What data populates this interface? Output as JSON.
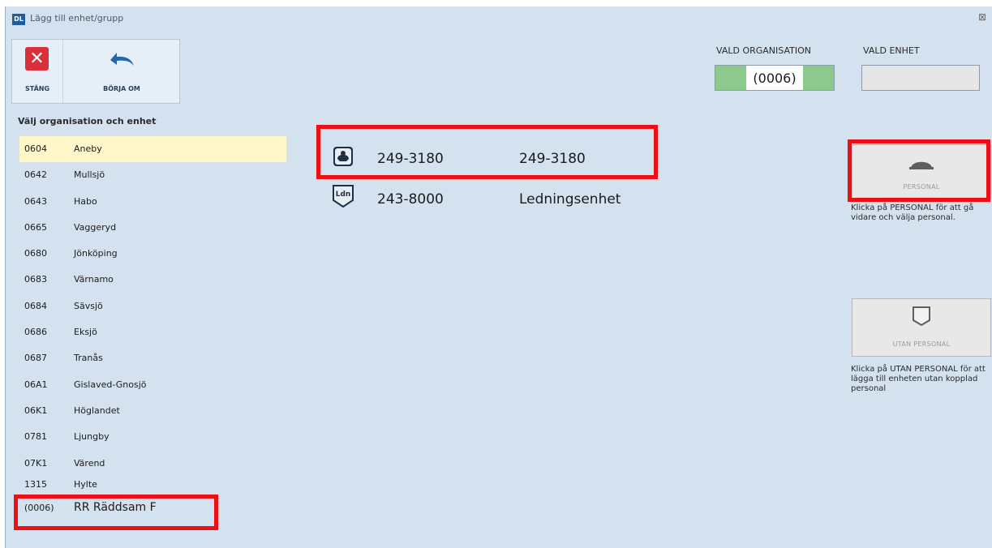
{
  "window": {
    "title": "Lägg till enhet/grupp",
    "app_icon_text": "DL",
    "close_glyph": "⊠"
  },
  "toolbar": {
    "close_label": "STÄNG",
    "restart_label": "BÖRJA OM"
  },
  "org_list": {
    "heading": "Välj organisation och enhet",
    "items": [
      {
        "code": "0604",
        "name": "Aneby"
      },
      {
        "code": "0642",
        "name": "Mullsjö"
      },
      {
        "code": "0643",
        "name": "Habo"
      },
      {
        "code": "0665",
        "name": "Vaggeryd"
      },
      {
        "code": "0680",
        "name": "Jönköping"
      },
      {
        "code": "0683",
        "name": "Värnamo"
      },
      {
        "code": "0684",
        "name": "Sävsjö"
      },
      {
        "code": "0686",
        "name": "Eksjö"
      },
      {
        "code": "0687",
        "name": "Tranås"
      },
      {
        "code": "06A1",
        "name": "Gislaved-Gnosjö"
      },
      {
        "code": "06K1",
        "name": "Höglandet"
      },
      {
        "code": "0781",
        "name": "Ljungby"
      },
      {
        "code": "07K1",
        "name": "Värend"
      },
      {
        "code": "1315",
        "name": "Hylte"
      },
      {
        "code": "(0006)",
        "name": "RR Räddsam F"
      }
    ]
  },
  "units": [
    {
      "code": "249-3180",
      "name": "249-3180",
      "icon": "helmet-badge-icon"
    },
    {
      "code": "243-8000",
      "name": "Ledningsenhet",
      "icon": "ldn-badge-icon",
      "badge_text": "Ldn"
    }
  ],
  "selection": {
    "org_label": "VALD ORGANISATION",
    "org_value": "(0006)",
    "org_accent": "#8cc98c",
    "unit_label": "VALD ENHET",
    "unit_value": ""
  },
  "actions": {
    "personal_label": "PERSONAL",
    "personal_hint": "Klicka på PERSONAL för att gå vidare och välja personal.",
    "utan_label": "UTAN PERSONAL",
    "utan_hint": "Klicka på UTAN PERSONAL för att lägga till enheten utan kopplad personal"
  },
  "colors": {
    "highlight": "#ee0f16",
    "selected_row": "#fff6c9",
    "window_bg": "#d4e2f0"
  }
}
